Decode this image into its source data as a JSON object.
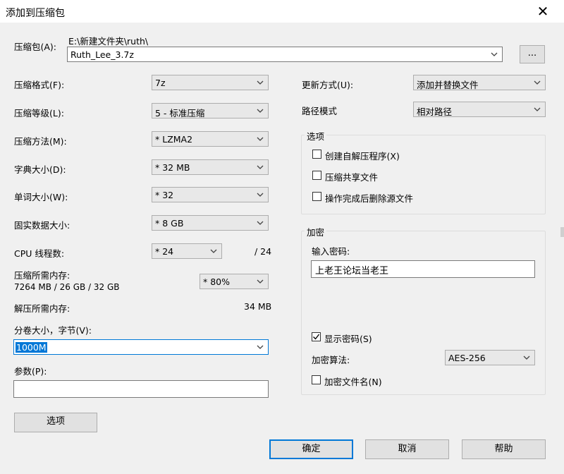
{
  "window": {
    "title": "添加到压缩包"
  },
  "archive": {
    "label": "压缩包(A):",
    "path": "E:\\新建文件夹\\ruth\\",
    "filename": "Ruth_Lee_3.7z",
    "browse_label": "..."
  },
  "left": {
    "format": {
      "label": "压缩格式(F):",
      "value": "7z"
    },
    "level": {
      "label": "压缩等级(L):",
      "value": "5 - 标准压缩"
    },
    "method": {
      "label": "压缩方法(M):",
      "value": "* LZMA2"
    },
    "dict": {
      "label": "字典大小(D):",
      "value": "* 32 MB"
    },
    "word": {
      "label": "单词大小(W):",
      "value": "* 32"
    },
    "solid": {
      "label": "固实数据大小:",
      "value": "* 8 GB"
    },
    "threads": {
      "label": "CPU 线程数:",
      "value": "* 24",
      "max": "/ 24"
    },
    "mem_compress": {
      "label": "压缩所需内存:",
      "detail": "7264 MB / 26 GB / 32 GB",
      "value": "* 80%"
    },
    "mem_decompress": {
      "label": "解压所需内存:",
      "value": "34 MB"
    },
    "volume": {
      "label": "分卷大小，字节(V):",
      "value": "1000M"
    },
    "params": {
      "label": "参数(P):",
      "value": ""
    },
    "options_button": "选项"
  },
  "right": {
    "update": {
      "label": "更新方式(U):",
      "value": "添加并替换文件"
    },
    "path_mode": {
      "label": "路径模式",
      "value": "相对路径"
    },
    "options_group": {
      "title": "选项",
      "sfx": {
        "label": "创建自解压程序(X)",
        "checked": false
      },
      "shared": {
        "label": "压缩共享文件",
        "checked": false
      },
      "delete": {
        "label": "操作完成后删除源文件",
        "checked": false
      }
    },
    "encryption": {
      "title": "加密",
      "password_label": "输入密码:",
      "password_value": "上老王论坛当老王",
      "show_password": {
        "label": "显示密码(S)",
        "checked": true
      },
      "method_label": "加密算法:",
      "method_value": "AES-256",
      "encrypt_names": {
        "label": "加密文件名(N)",
        "checked": false
      }
    }
  },
  "footer": {
    "ok": "确定",
    "cancel": "取消",
    "help": "帮助"
  },
  "icons": {
    "close": "✕",
    "check": "✓"
  },
  "colors": {
    "accent": "#0078d7",
    "window_bg": "#f0f0f0"
  }
}
